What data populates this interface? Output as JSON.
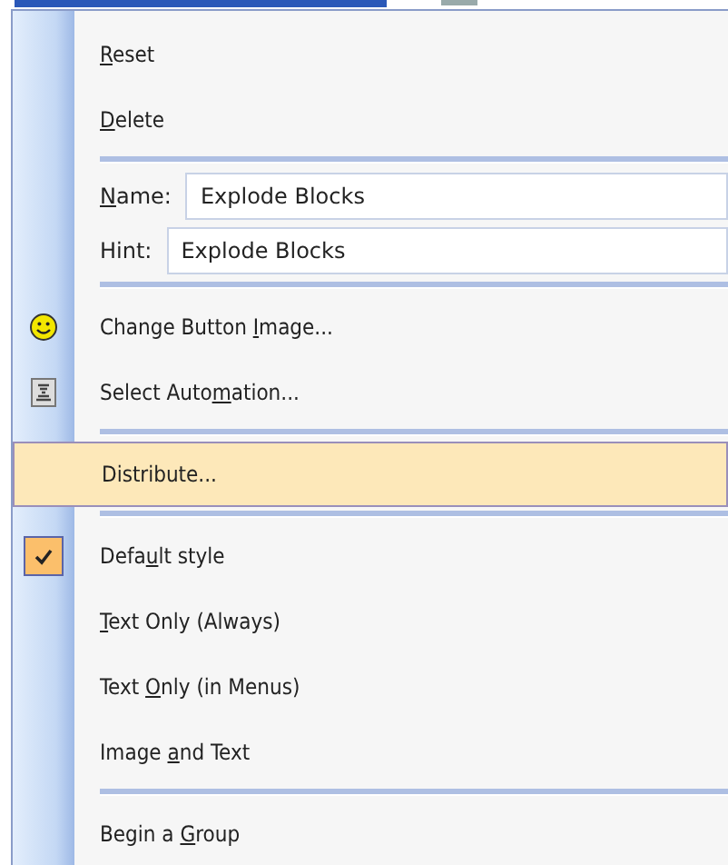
{
  "menu": {
    "items": [
      {
        "kind": "command",
        "label": {
          "key": "R",
          "after": "eset"
        },
        "selected": false,
        "checked": false
      },
      {
        "kind": "command",
        "label": {
          "key": "D",
          "after": "elete"
        },
        "selected": false,
        "checked": false
      },
      {
        "kind": "separator"
      },
      {
        "kind": "field",
        "label": {
          "key": "N",
          "after": "ame:"
        },
        "value": "Explode Blocks"
      },
      {
        "kind": "field",
        "label": {
          "before": "Hint:"
        },
        "value": "Explode Blocks"
      },
      {
        "kind": "separator"
      },
      {
        "kind": "command",
        "label": {
          "before": "Change Button ",
          "key": "I",
          "after": "mage..."
        },
        "selected": false,
        "checked": false
      },
      {
        "kind": "command",
        "label": {
          "before": "Select Auto",
          "key": "m",
          "after": "ation..."
        },
        "selected": false,
        "checked": false
      },
      {
        "kind": "separator"
      },
      {
        "kind": "command",
        "label": {
          "before": "Distribute..."
        },
        "selected": true,
        "checked": false
      },
      {
        "kind": "separator"
      },
      {
        "kind": "command",
        "label": {
          "before": "Defa",
          "key": "u",
          "after": "lt style"
        },
        "selected": false,
        "checked": true
      },
      {
        "kind": "command",
        "label": {
          "key": "T",
          "after": "ext Only (Always)"
        },
        "selected": false,
        "checked": false
      },
      {
        "kind": "command",
        "label": {
          "before": "Text ",
          "key": "O",
          "after": "nly (in Menus)"
        },
        "selected": false,
        "checked": false
      },
      {
        "kind": "command",
        "label": {
          "before": "Image ",
          "key": "a",
          "after": "nd Text"
        },
        "selected": false,
        "checked": false
      },
      {
        "kind": "separator"
      },
      {
        "kind": "command",
        "label": {
          "before": "Begin a ",
          "key": "G",
          "after": "roup"
        },
        "selected": false,
        "checked": false
      }
    ]
  }
}
